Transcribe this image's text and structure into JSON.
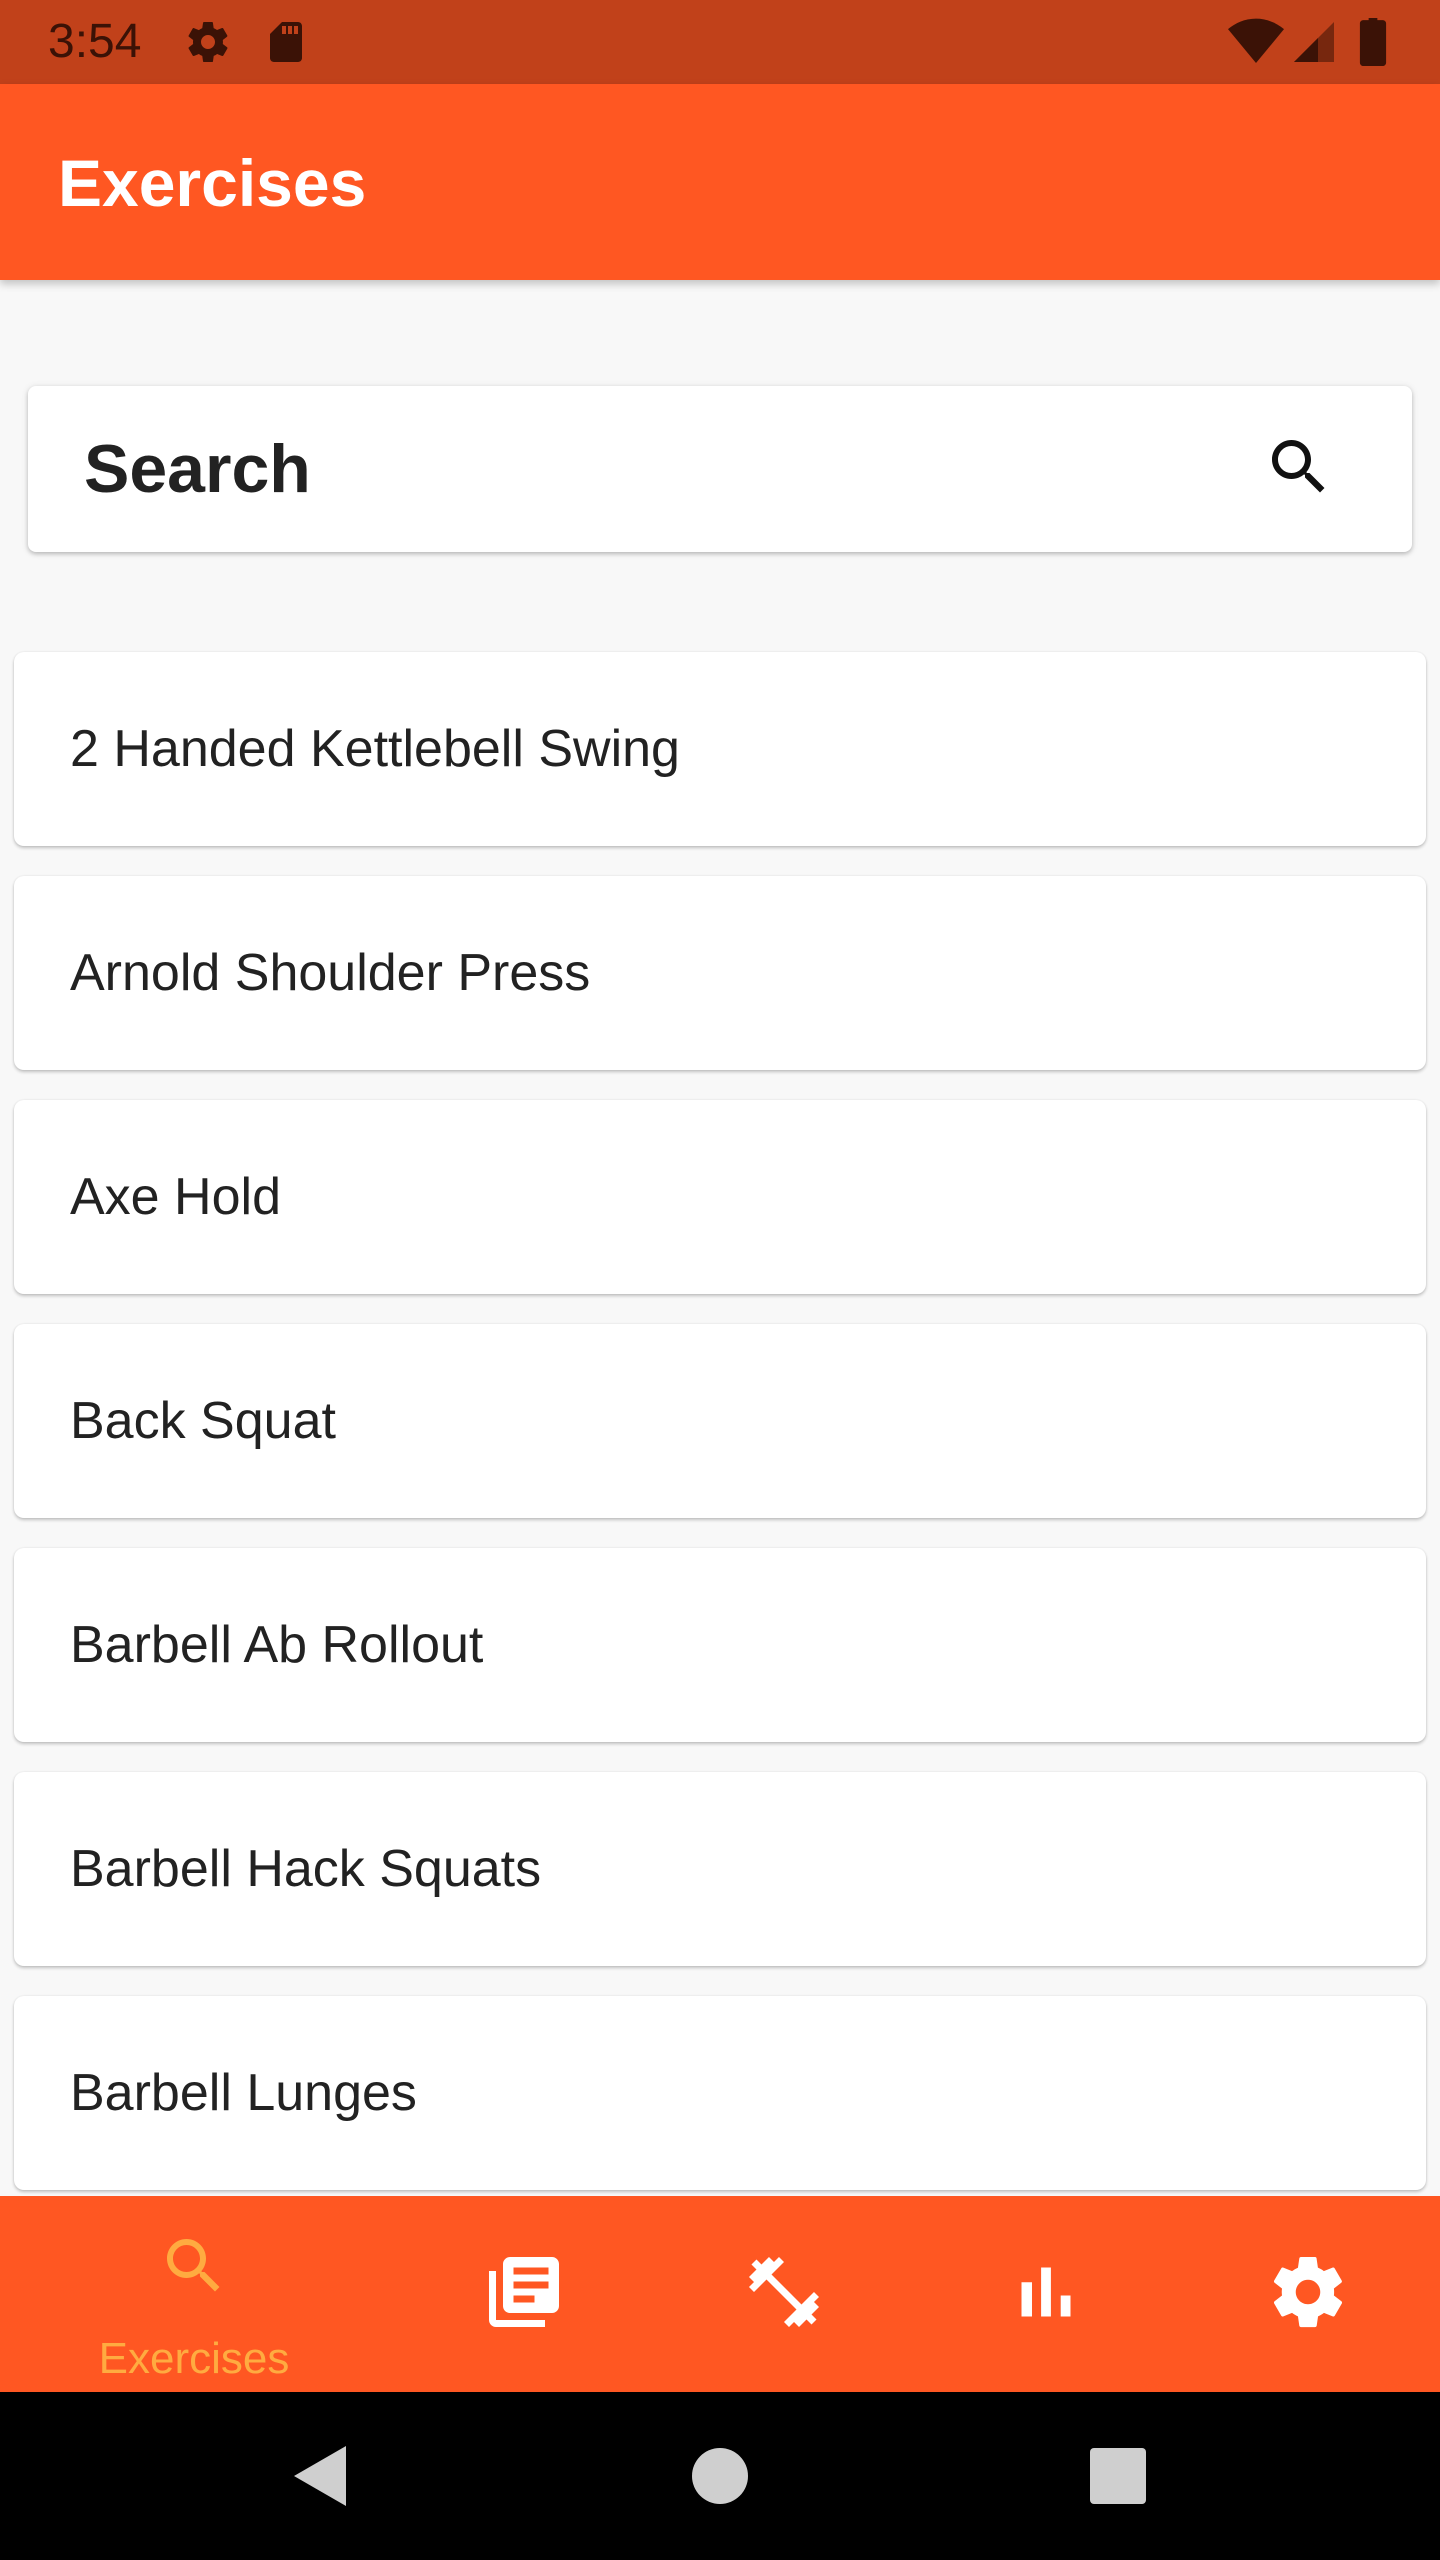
{
  "status_bar": {
    "time": "3:54",
    "icons": [
      "gear-icon",
      "sd-card-icon",
      "wifi-icon",
      "signal-icon",
      "battery-icon"
    ]
  },
  "app_bar": {
    "title": "Exercises"
  },
  "search": {
    "placeholder": "Search"
  },
  "exercises": [
    "2 Handed Kettlebell Swing",
    "Arnold Shoulder Press",
    "Axe Hold",
    "Back Squat",
    "Barbell Ab Rollout",
    "Barbell Hack Squats",
    "Barbell Lunges"
  ],
  "bottom_nav": {
    "active_label": "Exercises",
    "items": [
      "search-icon",
      "list-icon",
      "dumbbell-icon",
      "bar-chart-icon",
      "settings-icon"
    ]
  },
  "colors": {
    "status_bar": "#c1411a",
    "primary": "#ff5722",
    "active_nav": "#ffab40",
    "background": "#f8f8f8"
  }
}
